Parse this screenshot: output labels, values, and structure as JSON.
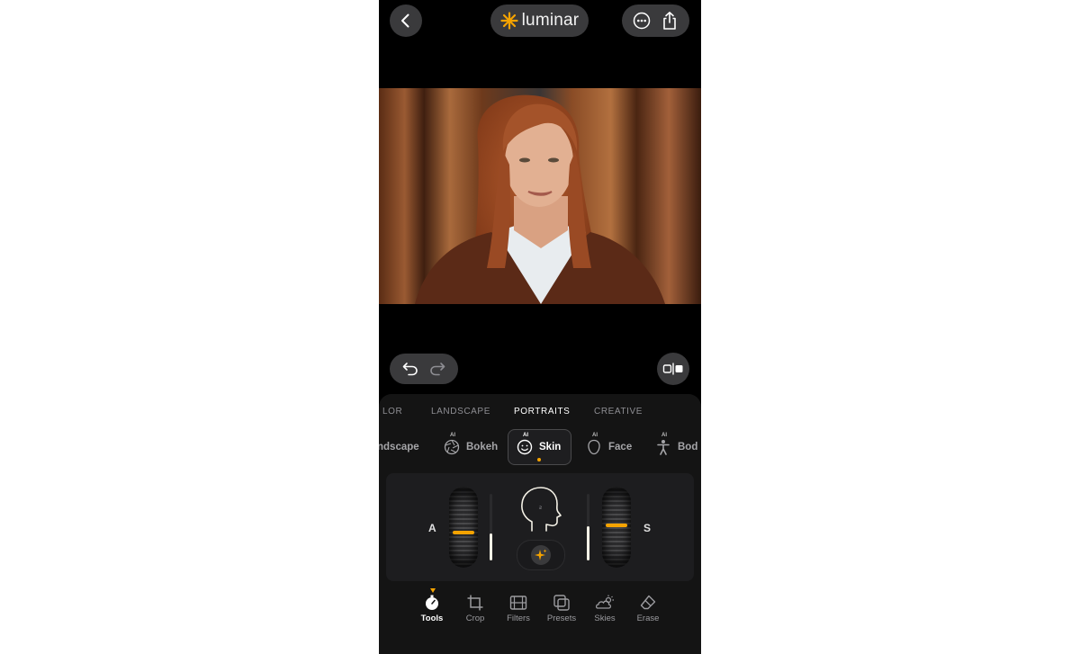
{
  "header": {
    "app_name": "luminar"
  },
  "categories": [
    "LOR",
    "LANDSCAPE",
    "PORTRAITS",
    "CREATIVE"
  ],
  "active_category": "PORTRAITS",
  "tools": [
    {
      "label": "ndscape",
      "ai": false
    },
    {
      "label": "Bokeh",
      "ai": true
    },
    {
      "label": "Skin",
      "ai": true
    },
    {
      "label": "Face",
      "ai": true
    },
    {
      "label": "Bod",
      "ai": true
    }
  ],
  "ai_badge": "AI",
  "selected_tool": "Skin",
  "sliders": {
    "left_label": "A",
    "right_label": "S",
    "left_value": 0.4,
    "right_value": 0.52
  },
  "bottom_nav": [
    {
      "label": "Tools",
      "icon": "tools-icon"
    },
    {
      "label": "Crop",
      "icon": "crop-icon"
    },
    {
      "label": "Filters",
      "icon": "filters-icon"
    },
    {
      "label": "Presets",
      "icon": "presets-icon"
    },
    {
      "label": "Skies",
      "icon": "skies-icon"
    },
    {
      "label": "Erase",
      "icon": "erase-icon"
    }
  ],
  "active_nav": "Tools",
  "colors": {
    "accent": "#f5a300",
    "background": "#000000",
    "panel": "#141414"
  }
}
